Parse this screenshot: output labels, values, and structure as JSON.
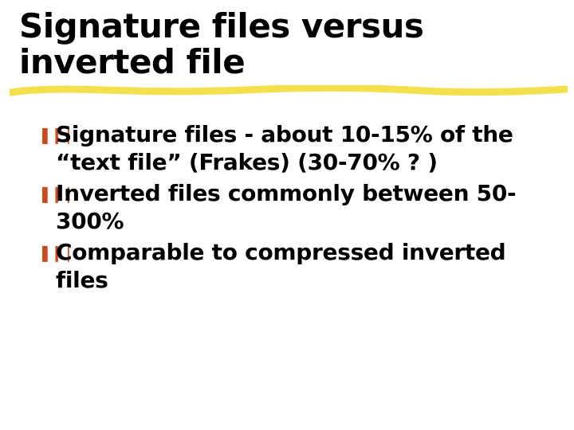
{
  "title": "Signature files versus inverted file",
  "bullet_glyph": "❚❙❘",
  "colors": {
    "underline": "#f4e04d",
    "bullet_glyph": "#c94a1a",
    "text": "#000000",
    "background": "#ffffff"
  },
  "bullets": [
    "Signature files - about 10-15% of the “text file” (Frakes) (30-70% ? )",
    "Inverted files commonly between 50-300%",
    "Comparable to compressed inverted files"
  ]
}
